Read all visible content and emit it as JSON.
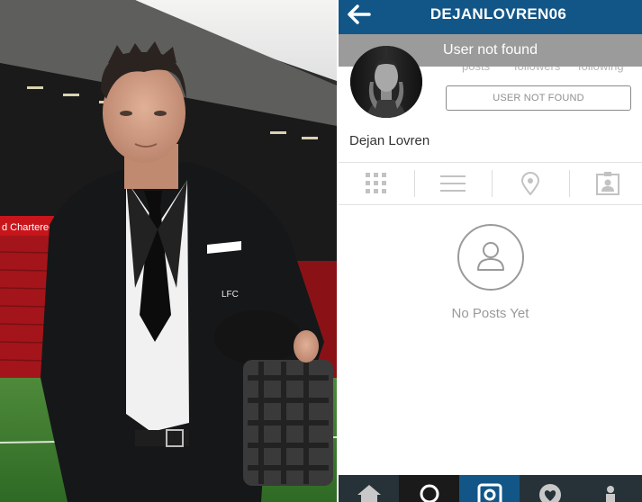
{
  "profile": {
    "username": "DEJANLOVREN06",
    "full_name": "Dejan Lovren",
    "toast": "User not found",
    "stat_labels": [
      "posts",
      "followers",
      "following"
    ],
    "status_button": "USER NOT FOUND"
  },
  "tabs": [
    "grid-icon",
    "list-icon",
    "map-pin-icon",
    "tagged-person-icon"
  ],
  "empty_state": {
    "text": "No Posts Yet",
    "icon": "person-icon"
  },
  "bottom_nav": [
    "home-icon",
    "search-icon",
    "camera-icon",
    "heart-icon",
    "profile-icon"
  ],
  "colors": {
    "header": "#125688",
    "toast": "#9b9b9b",
    "bottom_bar": "#263238",
    "active_tab": "#125688"
  }
}
